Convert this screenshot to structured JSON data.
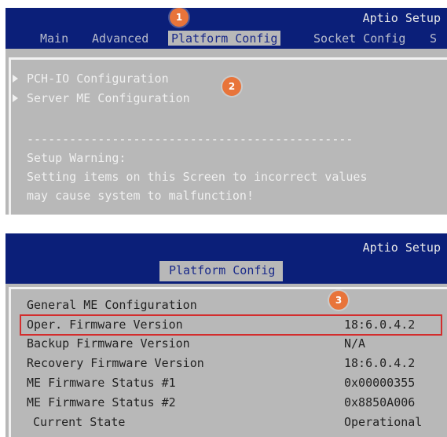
{
  "panel1": {
    "title": "Aptio Setup",
    "tabs": [
      "Main",
      "Advanced",
      "Platform Config",
      "Socket Config",
      "S"
    ],
    "active_tab_index": 2,
    "items": [
      "PCH-IO Configuration",
      "Server ME Configuration"
    ],
    "divider": "----------------------------------------------",
    "warning": {
      "title": "Setup Warning:",
      "line1": "Setting items on this Screen to incorrect values",
      "line2": "may cause system to malfunction!"
    },
    "badges": [
      "1",
      "2"
    ]
  },
  "panel2": {
    "title": "Aptio Setup",
    "tab": "Platform Config",
    "section_title": "General ME Configuration",
    "rows": [
      {
        "label": "Oper. Firmware Version",
        "value": "18:6.0.4.2"
      },
      {
        "label": "Backup Firmware Version",
        "value": "N/A"
      },
      {
        "label": "Recovery Firmware Version",
        "value": "18:6.0.4.2"
      },
      {
        "label": "ME Firmware Status #1",
        "value": "0x00000355"
      },
      {
        "label": "ME Firmware Status #2",
        "value": "0x8850A006"
      },
      {
        "label": "Current State",
        "value": "Operational"
      }
    ],
    "badge": "3",
    "colors": {
      "titlebar": "#0b1f79",
      "body": "#b8b8b8",
      "highlight": "#d32d2d",
      "badge": "#e8743a"
    }
  }
}
